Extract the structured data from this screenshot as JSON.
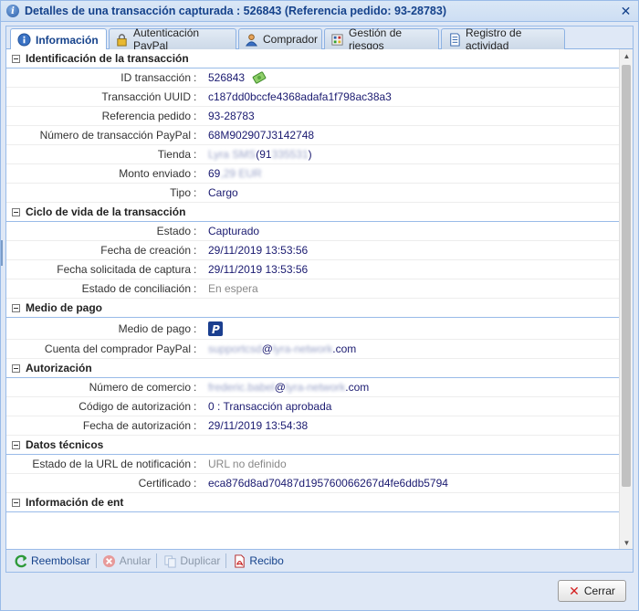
{
  "window": {
    "title": "Detalles de una transacción capturada : 526843 (Referencia pedido: 93-28783)",
    "close_icon": "close-icon"
  },
  "tabs": [
    {
      "label": "Información",
      "icon": "info-icon",
      "active": true
    },
    {
      "label": "Autenticación PayPal",
      "icon": "lock-icon",
      "active": false
    },
    {
      "label": "Comprador",
      "icon": "user-icon",
      "active": false
    },
    {
      "label": "Gestión de riesgos",
      "icon": "risk-icon",
      "active": false
    },
    {
      "label": "Registro de actividad",
      "icon": "log-icon",
      "active": false
    }
  ],
  "sections": {
    "identificacion": {
      "title": "Identificación de la transacción",
      "rows": [
        {
          "label": "ID transacción",
          "value": "526843"
        },
        {
          "label": "Transacción UUID",
          "value": "c187dd0bccfe4368adafa1f798ac38a3"
        },
        {
          "label": "Referencia pedido",
          "value": "93-28783"
        },
        {
          "label": "Número de transacción PayPal",
          "value": "68M902907J3142748"
        },
        {
          "label": "Tienda",
          "value_blur1": "Lyra SMS",
          "value_mid": " (91",
          "value_blur2": "335531",
          "value_end": ")"
        },
        {
          "label": "Monto enviado",
          "value_start": "69",
          "value_blur": ",29 EUR"
        },
        {
          "label": "Tipo",
          "value": "Cargo"
        }
      ]
    },
    "ciclo": {
      "title": "Ciclo de vida de la transacción",
      "rows": [
        {
          "label": "Estado",
          "value": "Capturado"
        },
        {
          "label": "Fecha de creación",
          "value": "29/11/2019 13:53:56"
        },
        {
          "label": "Fecha solicitada de captura",
          "value": "29/11/2019 13:53:56"
        },
        {
          "label": "Estado de conciliación",
          "value": "En espera"
        }
      ]
    },
    "medio": {
      "title": "Medio de pago",
      "rows": [
        {
          "label": "Medio de pago",
          "value_icon": "paypal-icon"
        },
        {
          "label": "Cuenta del comprador PayPal",
          "value_blur1": "supportcsd",
          "value_mid": "@",
          "value_blur2": "lyra-network",
          "value_end": ".com"
        }
      ]
    },
    "autorizacion": {
      "title": "Autorización",
      "rows": [
        {
          "label": "Número de comercio",
          "value_blur1": "frederic.babel",
          "value_mid": "@",
          "value_blur2": "lyra-network",
          "value_end": ".com"
        },
        {
          "label": "Código de autorización",
          "value": "0 : Transacción aprobada"
        },
        {
          "label": "Fecha de autorización",
          "value": "29/11/2019 13:54:38"
        }
      ]
    },
    "tecnicos": {
      "title": "Datos técnicos",
      "rows": [
        {
          "label": "Estado de la URL de notificación",
          "value": "URL no definido"
        },
        {
          "label": "Certificado",
          "value": "eca876d8ad70487d195760066267d4fe6ddb5794"
        }
      ]
    },
    "cut": {
      "title": "Información de ent"
    }
  },
  "colon": ":",
  "toolbar": {
    "reembolsar": "Reembolsar",
    "anular": "Anular",
    "duplicar": "Duplicar",
    "recibo": "Recibo"
  },
  "footer": {
    "close_label": "Cerrar"
  },
  "colors": {
    "accent": "#15428b",
    "border": "#99bbe8",
    "value": "#1a1a70"
  }
}
